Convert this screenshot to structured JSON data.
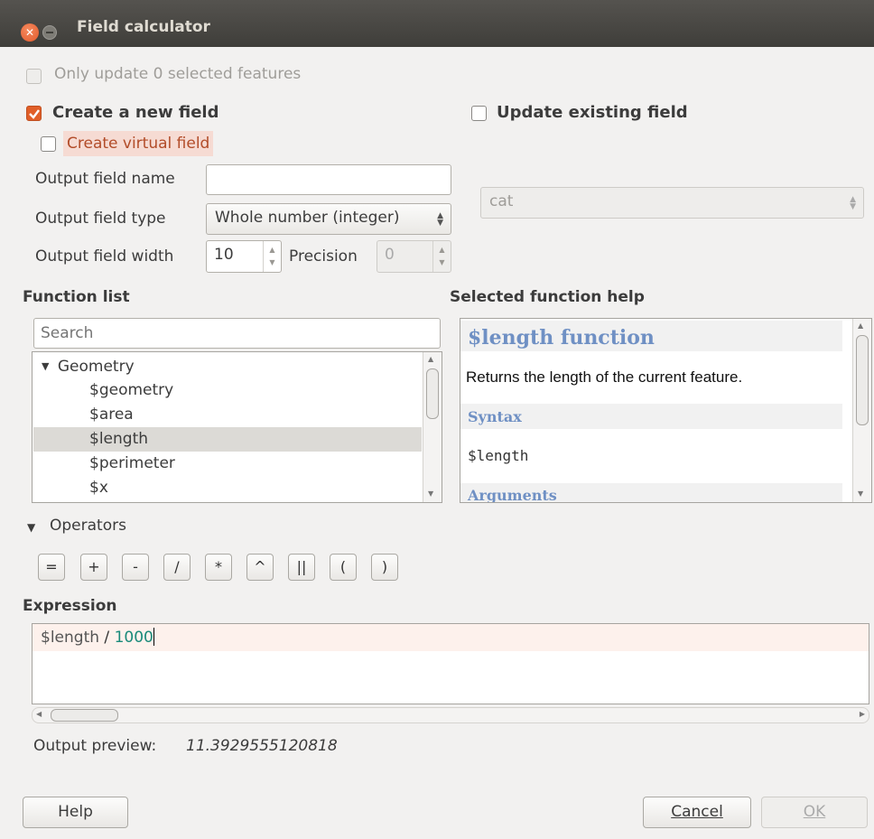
{
  "window": {
    "title": "Field calculator"
  },
  "only_update": {
    "label": "Only update 0 selected features",
    "checked": false
  },
  "create_new_field": {
    "label": "Create a new field",
    "checked": true
  },
  "update_existing": {
    "label": "Update existing field",
    "checked": false
  },
  "create_virtual": {
    "label": "Create virtual field",
    "checked": false
  },
  "output_field_name": {
    "label": "Output field name",
    "value": ""
  },
  "output_field_type": {
    "label": "Output field type",
    "value": "Whole number (integer)"
  },
  "output_field_width": {
    "label": "Output field width",
    "value": "10"
  },
  "precision": {
    "label": "Precision",
    "value": "0"
  },
  "existing_field_combo": {
    "value": "cat"
  },
  "function_list": {
    "heading": "Function list",
    "search_placeholder": "Search",
    "group": "Geometry",
    "items": [
      "$geometry",
      "$area",
      "$length",
      "$perimeter",
      "$x"
    ],
    "selected": "$length"
  },
  "help": {
    "heading": "Selected function help",
    "title": "$length function",
    "description": "Returns the length of the current feature.",
    "syntax_heading": "Syntax",
    "syntax": "$length",
    "arguments_heading": "Arguments"
  },
  "operators": {
    "label": "Operators",
    "buttons": [
      "=",
      "+",
      "-",
      "/",
      "*",
      "^",
      "||",
      "(",
      ")"
    ]
  },
  "expression": {
    "label": "Expression",
    "tokens": [
      "$length",
      " / ",
      "1000"
    ]
  },
  "output_preview": {
    "label": "Output preview:",
    "value": "11.3929555120818"
  },
  "buttons": {
    "help": "Help",
    "cancel": "Cancel",
    "ok": "OK"
  },
  "icons": {
    "close": "close-icon",
    "minimize": "minimize-icon",
    "checkmark": "checkmark-icon",
    "expand_triangle": "triangle-down-icon"
  },
  "colors": {
    "accent": "#e15f28",
    "selection": "#dcdad6",
    "help_heading": "#6f90c4",
    "number_token": "#1a8a7a",
    "expression_line": "#fdf1ec"
  }
}
